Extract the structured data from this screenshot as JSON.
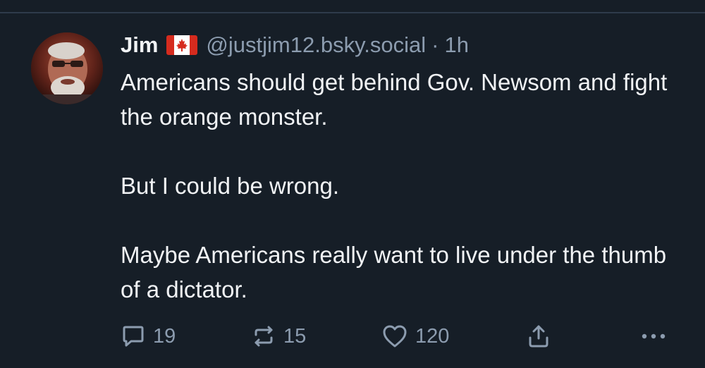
{
  "post": {
    "display_name": "Jim",
    "flag_icon": "canada-flag-icon",
    "handle": "@justjim12.bsky.social",
    "separator": "·",
    "time": "1h",
    "paragraphs": [
      "Americans should get behind Gov. Newsom and fight the orange monster.",
      "But I could be wrong.",
      "Maybe Americans really want to live under the thumb of a dictator."
    ]
  },
  "actions": {
    "reply_count": "19",
    "repost_count": "15",
    "like_count": "120"
  },
  "colors": {
    "background": "#161e27",
    "text": "#f1f3f5",
    "muted": "#8c9caf",
    "flag_red": "#d52b1e"
  }
}
